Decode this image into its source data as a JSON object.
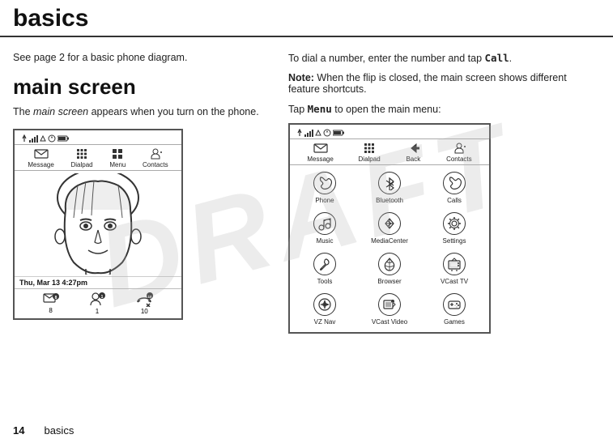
{
  "page": {
    "title": "basics",
    "footer": {
      "page_number": "14",
      "label": "basics"
    }
  },
  "draft_watermark": "DRAFT",
  "left_section": {
    "intro": "See page 2 for a basic phone diagram.",
    "heading": "main screen",
    "description_parts": [
      "The ",
      "main screen",
      " appears when you turn on the phone."
    ],
    "phone_screen": {
      "toolbar_items": [
        {
          "label": "Message",
          "icon": "message"
        },
        {
          "label": "Dialpad",
          "icon": "dialpad"
        },
        {
          "label": "Menu",
          "icon": "menu"
        },
        {
          "label": "Contacts",
          "icon": "contacts"
        }
      ],
      "date_time": "Thu, Mar 13 4:27pm",
      "bottom_items": [
        {
          "number": "8",
          "icon": "message-badge"
        },
        {
          "number": "1",
          "icon": "contact-badge"
        },
        {
          "number": "10",
          "icon": "missed-badge"
        }
      ]
    }
  },
  "right_section": {
    "call_text_parts": [
      "To dial a number, enter the number and tap ",
      "Call",
      "."
    ],
    "note_label": "Note:",
    "note_text": " When the flip is closed, the main screen shows different feature shortcuts.",
    "tap_text_parts": [
      "Tap ",
      "Menu",
      " to open the main menu:"
    ],
    "menu_screen": {
      "toolbar_items": [
        {
          "label": "Message",
          "icon": "message"
        },
        {
          "label": "Dialpad",
          "icon": "dialpad"
        },
        {
          "label": "Back",
          "icon": "back"
        },
        {
          "label": "Contacts",
          "icon": "contacts"
        }
      ],
      "grid_items": [
        {
          "label": "Phone",
          "icon": "phone"
        },
        {
          "label": "Bluetooth",
          "icon": "bluetooth"
        },
        {
          "label": "Calls",
          "icon": "calls"
        },
        {
          "label": "Music",
          "icon": "music"
        },
        {
          "label": "MediaCenter",
          "icon": "mediacenter"
        },
        {
          "label": "Settings",
          "icon": "settings"
        },
        {
          "label": "Tools",
          "icon": "tools"
        },
        {
          "label": "Browser",
          "icon": "browser"
        },
        {
          "label": "VCast TV",
          "icon": "vcast-tv"
        },
        {
          "label": "VZ Nav",
          "icon": "vz-nav"
        },
        {
          "label": "VCast Video",
          "icon": "vcast-video"
        },
        {
          "label": "Games",
          "icon": "games"
        }
      ]
    }
  }
}
